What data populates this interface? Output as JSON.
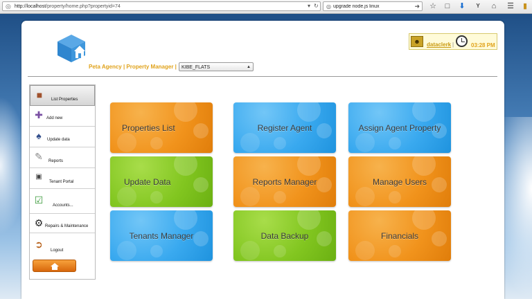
{
  "browser": {
    "url_host": "http://localhost",
    "url_path": "/property/home.php?propertyid=74",
    "search_text": "upgrade node.js linux"
  },
  "header": {
    "agency_text": "Peta Agency | Property Manager |",
    "property_selected": "KIBE_FLATS",
    "username": "dataclerk",
    "separator": "|",
    "time": "03:28 PM"
  },
  "sidebar": {
    "items": [
      {
        "label": "List Properties",
        "icon": "properties-icon"
      },
      {
        "label": "Add new",
        "icon": "add-new-icon"
      },
      {
        "label": "Update data",
        "icon": "update-data-icon"
      },
      {
        "label": "Reports",
        "icon": "reports-icon"
      },
      {
        "label": "Tenant Portal",
        "icon": "tenant-portal-icon"
      },
      {
        "label": "Accounts...",
        "icon": "accounts-icon"
      },
      {
        "label": "Repairs & Maintenance",
        "icon": "repairs-icon"
      },
      {
        "label": "Logout",
        "icon": "logout-icon"
      }
    ],
    "home_icon": "home-icon"
  },
  "tiles": [
    {
      "label": "Properties List",
      "color": "#f1931c"
    },
    {
      "label": "Register Agent",
      "color": "#39a9ef"
    },
    {
      "label": "Assign Agent Property",
      "color": "#39a9ef"
    },
    {
      "label": "Update Data",
      "color": "#82c620"
    },
    {
      "label": "Reports Manager",
      "color": "#f1931c"
    },
    {
      "label": "Manage Users",
      "color": "#f1931c"
    },
    {
      "label": "Tenants Manager",
      "color": "#39a9ef"
    },
    {
      "label": "Data Backup",
      "color": "#82c620"
    },
    {
      "label": "Financials",
      "color": "#f1931c"
    }
  ]
}
